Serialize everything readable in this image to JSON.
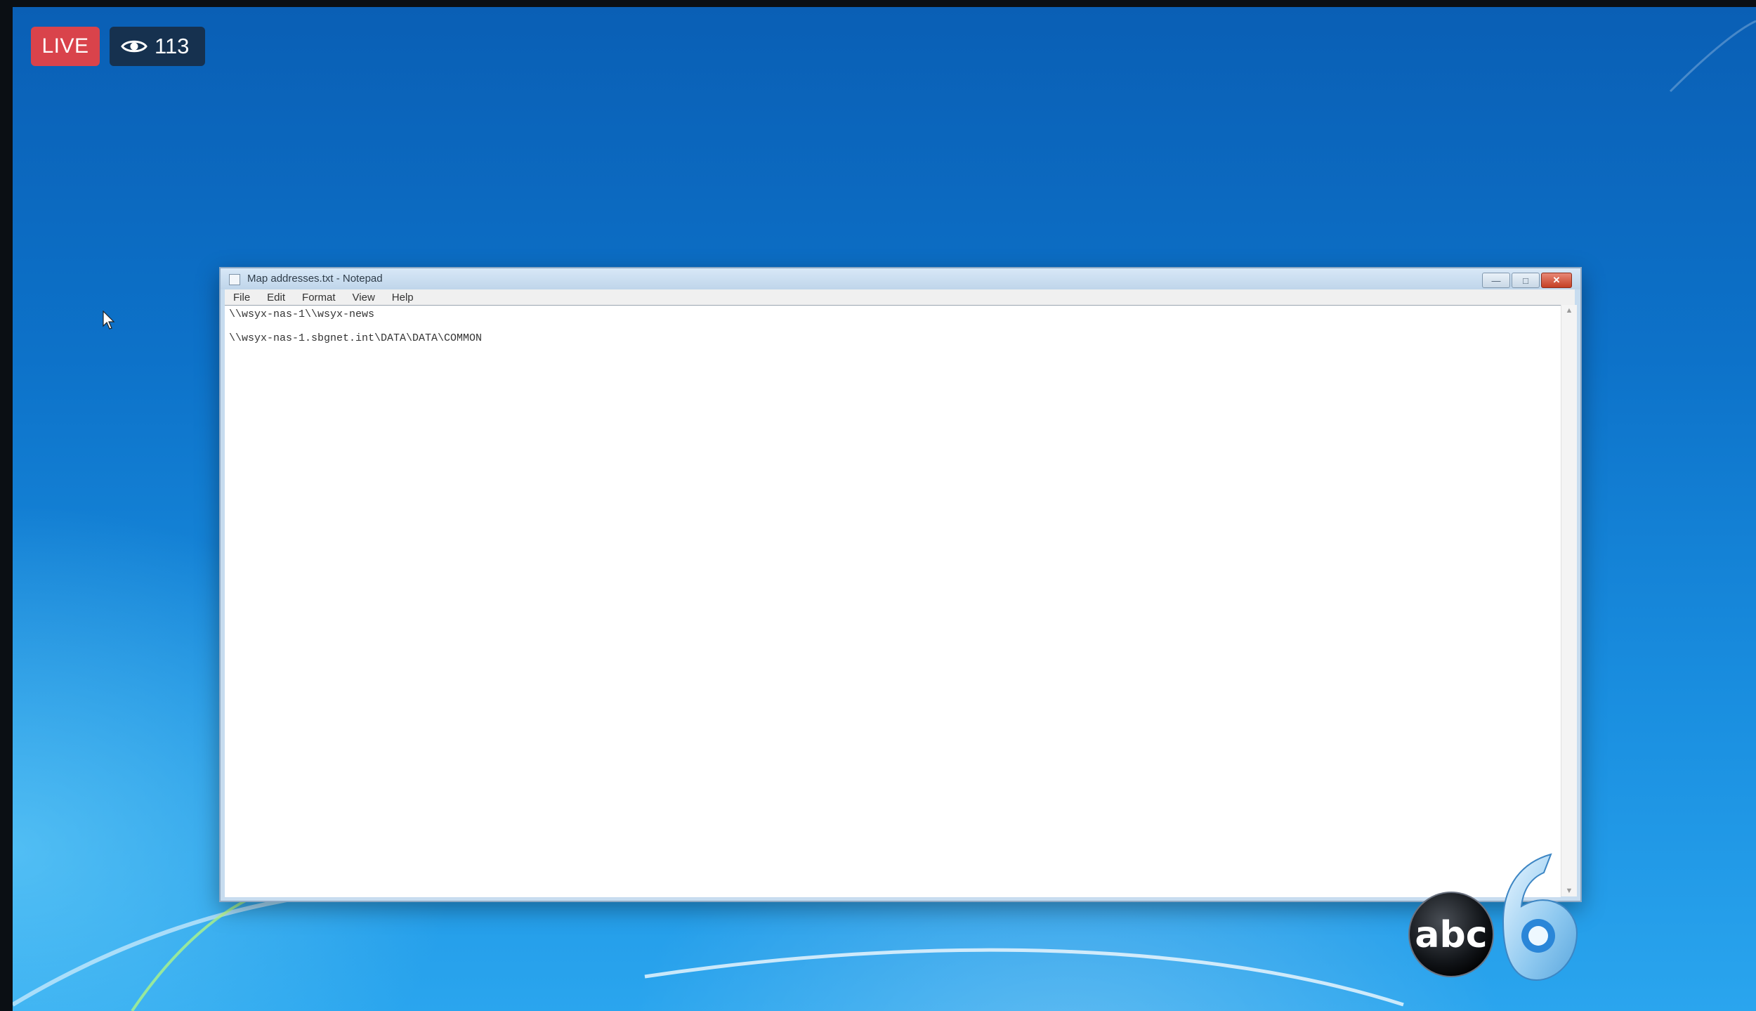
{
  "stream": {
    "live_label": "LIVE",
    "viewer_count": "113"
  },
  "window": {
    "title": "Map addresses.txt - Notepad",
    "menu": [
      "File",
      "Edit",
      "Format",
      "View",
      "Help"
    ],
    "lines": [
      "\\\\wsyx-nas-1\\\\wsyx-news",
      "\\\\wsyx-nas-1.sbgnet.int\\DATA\\DATA\\COMMON"
    ]
  },
  "logo": {
    "network": "abc",
    "channel": "6"
  }
}
